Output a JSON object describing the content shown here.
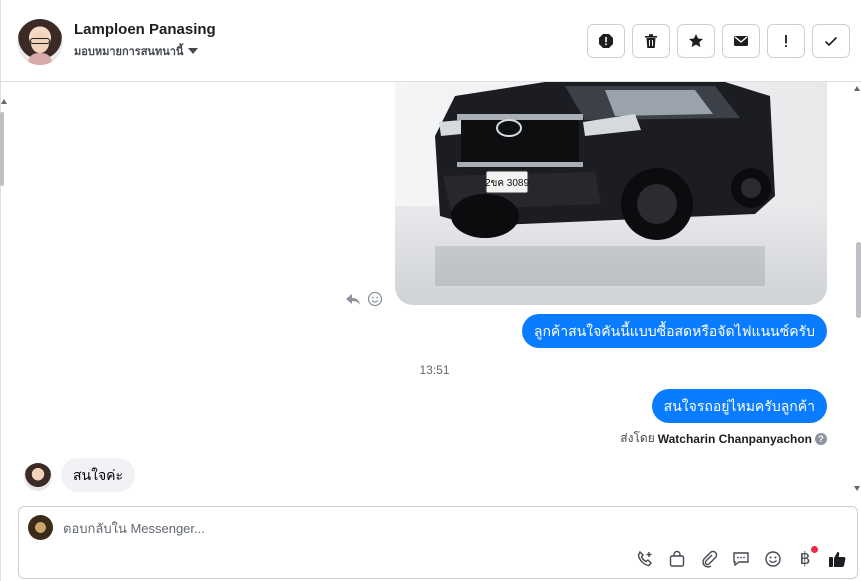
{
  "header": {
    "contact_name": "Lamploen Panasing",
    "assign_label": "มอบหมายการสนทนานี้",
    "actions": [
      {
        "name": "spam-icon"
      },
      {
        "name": "trash-icon"
      },
      {
        "name": "star-icon"
      },
      {
        "name": "mail-icon"
      },
      {
        "name": "mark-important-icon"
      },
      {
        "name": "check-icon"
      }
    ]
  },
  "thread": {
    "photo_plate": "2ขค 3089",
    "messages": [
      {
        "from": "page",
        "text": "ลูกค้าสนใจคันนี้แบบซื้อสดหรือจัดไฟแนนซ์ครับ"
      },
      {
        "from": "page",
        "text": "สนใจรถอยู่ไหมครับลูกค้า"
      },
      {
        "from": "customer",
        "text": "สนใจค่ะ"
      }
    ],
    "timestamp": "13:51",
    "sent_by_label": "ส่งโดย",
    "sent_by_name": "Watcharin Chanpanyachon",
    "help_glyph": "?"
  },
  "composer": {
    "placeholder": "ตอบกลับใน Messenger...",
    "value": "",
    "currency_glyph": "฿"
  },
  "colors": {
    "outgoing_bubble": "#0a7cff",
    "incoming_bubble": "#f0f2f5",
    "border": "#ccd0d5",
    "notification_dot": "#f02849"
  }
}
